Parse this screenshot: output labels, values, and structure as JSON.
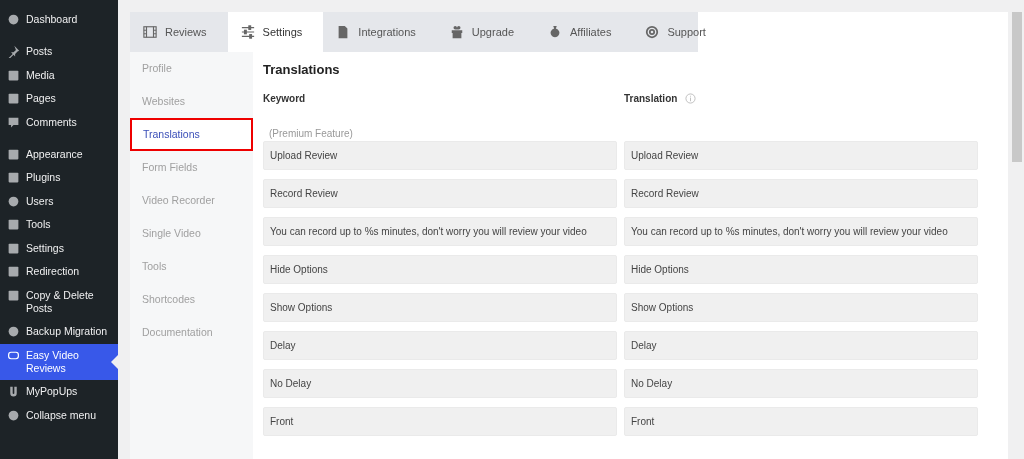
{
  "sidebar": {
    "groups": [
      [
        {
          "label": "Dashboard",
          "selected": false
        }
      ],
      [
        {
          "label": "Posts",
          "selected": false
        },
        {
          "label": "Media",
          "selected": false
        },
        {
          "label": "Pages",
          "selected": false
        },
        {
          "label": "Comments",
          "selected": false
        }
      ],
      [
        {
          "label": "Appearance",
          "selected": false
        },
        {
          "label": "Plugins",
          "selected": false
        },
        {
          "label": "Users",
          "selected": false
        },
        {
          "label": "Tools",
          "selected": false
        },
        {
          "label": "Settings",
          "selected": false
        },
        {
          "label": "Redirection",
          "selected": false
        },
        {
          "label": "Copy & Delete Posts",
          "selected": false
        },
        {
          "label": "Backup Migration",
          "selected": false
        },
        {
          "label": "Easy Video Reviews",
          "selected": true
        },
        {
          "label": "MyPopUps",
          "selected": false
        },
        {
          "label": "Collapse menu",
          "selected": false
        }
      ]
    ]
  },
  "tabs": [
    {
      "label": "Reviews",
      "selected": false
    },
    {
      "label": "Settings",
      "selected": true
    },
    {
      "label": "Integrations",
      "selected": false
    },
    {
      "label": "Upgrade",
      "selected": false
    },
    {
      "label": "Affiliates",
      "selected": false
    },
    {
      "label": "Support",
      "selected": false
    }
  ],
  "submenu": [
    {
      "label": "Profile",
      "selected": false
    },
    {
      "label": "Websites",
      "selected": false
    },
    {
      "label": "Translations",
      "selected": true
    },
    {
      "label": "Form Fields",
      "selected": false
    },
    {
      "label": "Video Recorder",
      "selected": false
    },
    {
      "label": "Single Video",
      "selected": false
    },
    {
      "label": "Tools",
      "selected": false
    },
    {
      "label": "Shortcodes",
      "selected": false
    },
    {
      "label": "Documentation",
      "selected": false
    }
  ],
  "section_title": "Translations",
  "columns": [
    "Keyword",
    "Translation"
  ],
  "note": "(Premium Feature)",
  "rows": [
    {
      "keyword": "Upload Review",
      "translation": "Upload Review"
    },
    {
      "keyword": "Record Review",
      "translation": "Record Review"
    },
    {
      "keyword": "You can record up to %s minutes, don't worry you will review your video",
      "translation": "You can record up to %s minutes, don't worry you will review your video"
    },
    {
      "keyword": "Hide Options",
      "translation": "Hide Options"
    },
    {
      "keyword": "Show Options",
      "translation": "Show Options"
    },
    {
      "keyword": "Delay",
      "translation": "Delay"
    },
    {
      "keyword": "No Delay",
      "translation": "No Delay"
    },
    {
      "keyword": "Front",
      "translation": "Front"
    }
  ]
}
